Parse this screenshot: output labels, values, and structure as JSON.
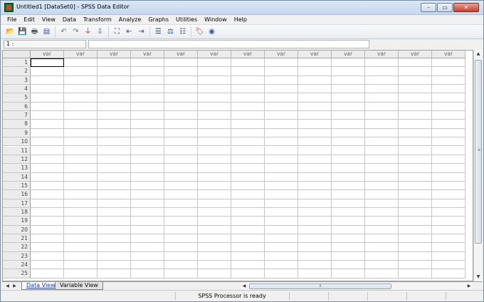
{
  "window": {
    "title": "Untitled1 [DataSet0] - SPSS Data Editor",
    "minimize_glyph": "–",
    "maximize_glyph": "▭",
    "close_glyph": "✕"
  },
  "menu": [
    "File",
    "Edit",
    "View",
    "Data",
    "Transform",
    "Analyze",
    "Graphs",
    "Utilities",
    "Window",
    "Help"
  ],
  "toolbar": {
    "groups": [
      [
        {
          "icon": "open-folder-icon",
          "glyph": "📂",
          "color": "#d9a520"
        },
        {
          "icon": "save-icon",
          "glyph": "💾",
          "color": "#3a5fa8"
        },
        {
          "icon": "print-icon",
          "glyph": "🖶",
          "color": "#555555"
        },
        {
          "icon": "dialog-recall-icon",
          "glyph": "▤",
          "color": "#2d5aa0"
        }
      ],
      [
        {
          "icon": "undo-icon",
          "glyph": "↶",
          "color": "#707070"
        },
        {
          "icon": "redo-icon",
          "glyph": "↷",
          "color": "#707070"
        },
        {
          "icon": "goto-case-icon",
          "glyph": "⏚",
          "color": "#b04020"
        },
        {
          "icon": "goto-variable-icon",
          "glyph": "⇩",
          "color": "#2d5aa0"
        }
      ],
      [
        {
          "icon": "find-icon",
          "glyph": "⛶",
          "color": "#404040"
        },
        {
          "icon": "insert-cases-icon",
          "glyph": "⇤",
          "color": "#2d5aa0"
        },
        {
          "icon": "insert-variable-icon",
          "glyph": "⇥",
          "color": "#2d5aa0"
        }
      ],
      [
        {
          "icon": "split-file-icon",
          "glyph": "☰",
          "color": "#1e3d7a"
        },
        {
          "icon": "weight-cases-icon",
          "glyph": "⚖",
          "color": "#1e3d7a"
        },
        {
          "icon": "select-cases-icon",
          "glyph": "☷",
          "color": "#1e3d7a"
        }
      ],
      [
        {
          "icon": "value-labels-icon",
          "glyph": "🏷",
          "color": "#b03030"
        },
        {
          "icon": "use-sets-icon",
          "glyph": "◉",
          "color": "#2d5aa0"
        }
      ]
    ]
  },
  "editbar": {
    "cell_ref": "1 :",
    "cell_value": ""
  },
  "grid": {
    "column_header": "var",
    "column_count": 13,
    "rows": [
      "1",
      "2",
      "3",
      "4",
      "5",
      "6",
      "7",
      "8",
      "9",
      "10",
      "11",
      "12",
      "13",
      "14",
      "15",
      "16",
      "17",
      "18",
      "19",
      "20",
      "21",
      "22",
      "23",
      "24",
      "25"
    ],
    "active_cell": {
      "row": 1,
      "col": 1
    }
  },
  "tabs": [
    {
      "label": "Data View",
      "active": true
    },
    {
      "label": "Variable View",
      "active": false
    }
  ],
  "scroll_glyphs": {
    "up": "▲",
    "down": "▼",
    "left": "◀",
    "right": "▶",
    "grip_v": "≡",
    "grip_h": "⦀",
    "tab_prev": "◀",
    "tab_next": "▶"
  },
  "status": {
    "text": "SPSS Processor is ready"
  },
  "colors": {
    "title_gradient_top": "#dbe7f6",
    "close_button": "#c7402f",
    "grid_line": "#c6c6c6",
    "header_bg": "#ececec"
  }
}
